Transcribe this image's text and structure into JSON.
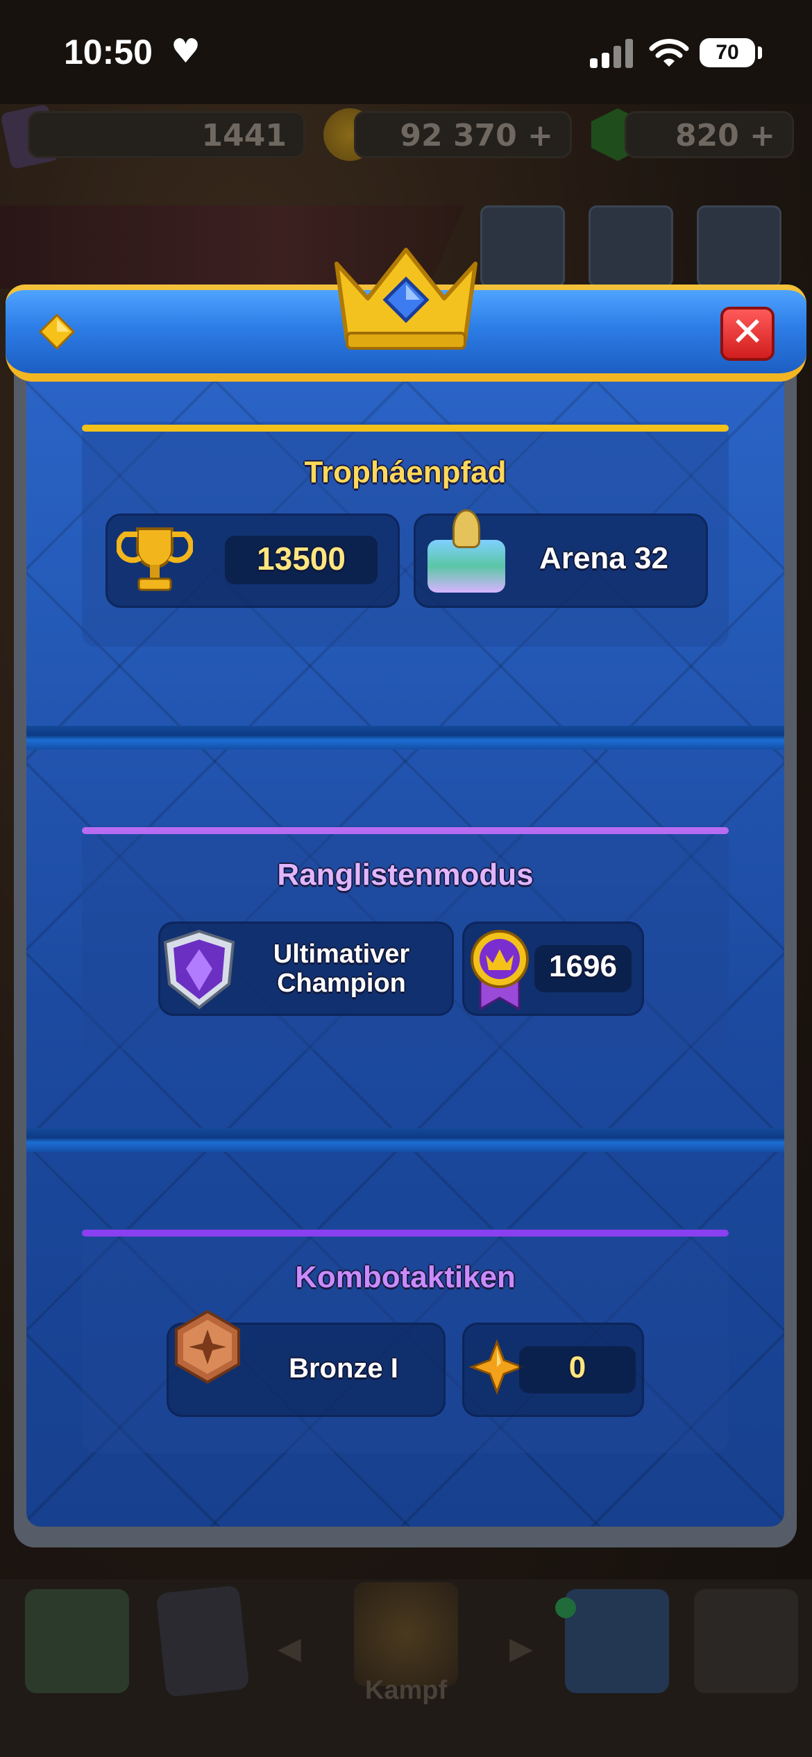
{
  "status_bar": {
    "time": "10:50",
    "battery": "70"
  },
  "currencies": {
    "cards": "1441",
    "gold": "92 370",
    "gems": "820",
    "plus": "+"
  },
  "bottom_nav": {
    "battle_label": "Kampf"
  },
  "modal": {
    "close_symbol": "✕",
    "trophy_road": {
      "title": "Tropháenpfad",
      "trophies": "13500",
      "arena": "Arena 32"
    },
    "ranked": {
      "title": "Ranglistenmodus",
      "league_line1": "Ultimativer",
      "league_line2": "Champion",
      "rating": "1696"
    },
    "combo": {
      "title": "Kombotaktiken",
      "rank": "Bronze I",
      "points": "0"
    }
  },
  "colors": {
    "gold_line": "#f2c21b",
    "purple_line": "#b86cf2",
    "violet_line": "#8a3ff0",
    "title_gold": "#ffd95a",
    "title_purple": "#e0b6ff",
    "title_violet": "#c98bff"
  }
}
